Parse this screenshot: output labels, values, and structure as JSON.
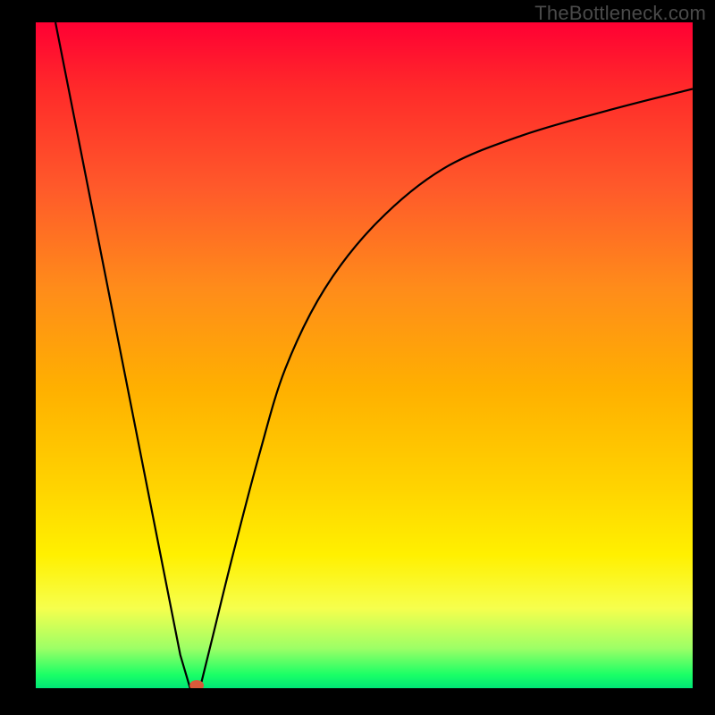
{
  "branding": {
    "text": "TheBottleneck.com"
  },
  "chart_data": {
    "type": "line",
    "title": "",
    "xlabel": "",
    "ylabel": "",
    "xlim": [
      0,
      100
    ],
    "ylim": [
      0,
      100
    ],
    "grid": false,
    "legend": false,
    "background_gradient": {
      "direction": "vertical",
      "stops": [
        {
          "pos": 0.0,
          "color": "#ff0033"
        },
        {
          "pos": 0.4,
          "color": "#ff8c1a"
        },
        {
          "pos": 0.8,
          "color": "#fff000"
        },
        {
          "pos": 1.0,
          "color": "#00e676"
        }
      ]
    },
    "series": [
      {
        "name": "left-branch",
        "x": [
          3,
          7,
          11,
          15,
          19,
          22,
          23.5
        ],
        "values": [
          100,
          80,
          60,
          40,
          20,
          5,
          0
        ]
      },
      {
        "name": "right-branch",
        "x": [
          25,
          27,
          30,
          34,
          38,
          44,
          52,
          62,
          74,
          88,
          100
        ],
        "values": [
          0,
          8,
          20,
          35,
          48,
          60,
          70,
          78,
          83,
          87,
          90
        ]
      }
    ],
    "marker": {
      "name": "valley-marker",
      "x": 24.5,
      "y": 0,
      "color": "#d95a3a",
      "rx": 8,
      "ry": 6
    }
  }
}
